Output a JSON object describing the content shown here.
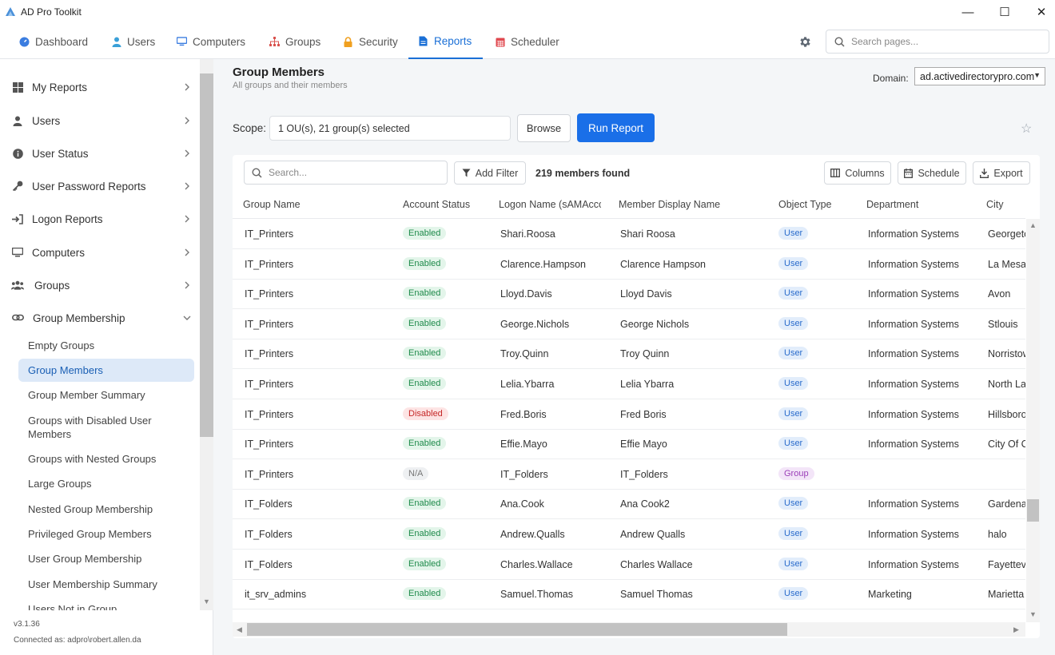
{
  "app": {
    "title": "AD Pro Toolkit",
    "minimize": "—",
    "maximize": "☐",
    "close": "✕"
  },
  "nav": {
    "tabs": [
      {
        "label": "Dashboard"
      },
      {
        "label": "Users"
      },
      {
        "label": "Computers"
      },
      {
        "label": "Groups"
      },
      {
        "label": "Security"
      },
      {
        "label": "Reports"
      },
      {
        "label": "Scheduler"
      }
    ],
    "active_tab": "Reports",
    "search_placeholder": "Search pages..."
  },
  "sidebar": {
    "items": [
      {
        "label": "My Reports",
        "icon": "grid-icon"
      },
      {
        "label": "Users",
        "icon": "user-icon"
      },
      {
        "label": "User Status",
        "icon": "info-icon"
      },
      {
        "label": "User Password Reports",
        "icon": "key-icon"
      },
      {
        "label": "Logon Reports",
        "icon": "login-icon"
      },
      {
        "label": "Computers",
        "icon": "monitor-icon"
      },
      {
        "label": "Groups",
        "icon": "users-icon"
      },
      {
        "label": "Group Membership",
        "icon": "link-icon"
      }
    ],
    "subitems": [
      {
        "label": "Empty Groups"
      },
      {
        "label": "Group Members"
      },
      {
        "label": "Group Member Summary"
      },
      {
        "label": "Groups with Disabled User Members"
      },
      {
        "label": "Groups with Nested Groups"
      },
      {
        "label": "Large Groups"
      },
      {
        "label": "Nested Group Membership"
      },
      {
        "label": "Privileged Group Members"
      },
      {
        "label": "User Group Membership"
      },
      {
        "label": "User Membership Summary"
      },
      {
        "label": "Users Not in Group"
      }
    ],
    "active_subitem": "Group Members",
    "version": "v3.1.36",
    "connected": "Connected as: adpro\\robert.allen.da"
  },
  "page": {
    "title": "Group Members",
    "subtitle": "All groups and their members",
    "domain_label": "Domain:",
    "domain_value": "ad.activedirectorypro.com",
    "scope_label": "Scope:",
    "scope_value": "1 OU(s), 21 group(s) selected",
    "browse_label": "Browse",
    "run_label": "Run Report",
    "star": "☆"
  },
  "table": {
    "search_placeholder": "Search...",
    "add_filter": "Add Filter",
    "count": "219 members found",
    "columns_btn": "Columns",
    "schedule_btn": "Schedule",
    "export_btn": "Export",
    "headers": [
      "Group Name",
      "Account Status",
      "Logon Name (sAMAccc",
      "Member Display Name",
      "Object Type",
      "Department",
      "City"
    ],
    "rows": [
      [
        "IT_Printers",
        "Enabled",
        "Shari.Roosa",
        "Shari Roosa",
        "User",
        "Information Systems",
        "Georgetown"
      ],
      [
        "IT_Printers",
        "Enabled",
        "Clarence.Hampson",
        "Clarence Hampson",
        "User",
        "Information Systems",
        "La Mesa"
      ],
      [
        "IT_Printers",
        "Enabled",
        "Lloyd.Davis",
        "Lloyd Davis",
        "User",
        "Information Systems",
        "Avon"
      ],
      [
        "IT_Printers",
        "Enabled",
        "George.Nichols",
        "George Nichols",
        "User",
        "Information Systems",
        "Stlouis"
      ],
      [
        "IT_Printers",
        "Enabled",
        "Troy.Quinn",
        "Troy Quinn",
        "User",
        "Information Systems",
        "Norristown"
      ],
      [
        "IT_Printers",
        "Enabled",
        "Lelia.Ybarra",
        "Lelia Ybarra",
        "User",
        "Information Systems",
        "North Las Vegas"
      ],
      [
        "IT_Printers",
        "Disabled",
        "Fred.Boris",
        "Fred Boris",
        "User",
        "Information Systems",
        "Hillsborough"
      ],
      [
        "IT_Printers",
        "Enabled",
        "Effie.Mayo",
        "Effie Mayo",
        "User",
        "Information Systems",
        "City Of Commerce"
      ],
      [
        "IT_Printers",
        "N/A",
        "IT_Folders",
        "IT_Folders",
        "Group",
        "",
        ""
      ],
      [
        "IT_Folders",
        "Enabled",
        "Ana.Cook",
        "Ana Cook2",
        "User",
        "Information Systems",
        "Gardena"
      ],
      [
        "IT_Folders",
        "Enabled",
        "Andrew.Qualls",
        "Andrew Qualls",
        "User",
        "Information Systems",
        "halo"
      ],
      [
        "IT_Folders",
        "Enabled",
        "Charles.Wallace",
        "Charles Wallace",
        "User",
        "Information Systems",
        "Fayetteville"
      ],
      [
        "it_srv_admins",
        "Enabled",
        "Samuel.Thomas",
        "Samuel Thomas",
        "User",
        "Marketing",
        "Marietta"
      ]
    ]
  },
  "colors": {
    "accent": "#1a6fe8",
    "enabled": "#1e8a4a",
    "disabled": "#c62828",
    "group": "#9b3fb8"
  }
}
